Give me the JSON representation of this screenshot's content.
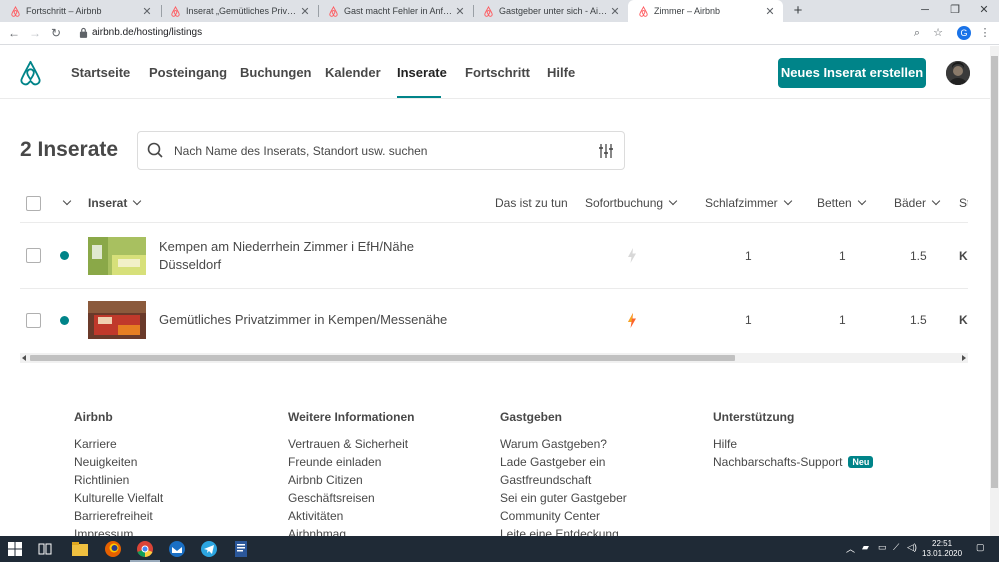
{
  "browser": {
    "tabs": [
      {
        "title": "Fortschritt – Airbnb"
      },
      {
        "title": "Inserat „Gemütliches Privatzimmer"
      },
      {
        "title": "Gast macht Fehler in Anfrage, ke"
      },
      {
        "title": "Gastgeber unter sich - Airbnb Co"
      },
      {
        "title": "Zimmer – Airbnb"
      }
    ],
    "url": "airbnb.de/hosting/listings"
  },
  "header": {
    "nav": [
      "Startseite",
      "Posteingang",
      "Buchungen",
      "Kalender",
      "Inserate",
      "Fortschritt",
      "Hilfe"
    ],
    "active_nav": "Inserate",
    "new_listing_label": "Neues Inserat erstellen"
  },
  "listings": {
    "count_label": "2 Inserate",
    "search_placeholder": "Nach Name des Inserats, Standort usw. suchen",
    "columns": [
      "Inserat",
      "Das ist zu tun",
      "Sofortbuchung",
      "Schlafzimmer",
      "Betten",
      "Bäder",
      "St"
    ],
    "rows": [
      {
        "title": "Kempen am Niederrhein Zimmer i EfH/Nähe Düsseldorf",
        "instant_book": "off",
        "bedrooms": "1",
        "beds": "1",
        "baths": "1.5",
        "status_partial": "Ke"
      },
      {
        "title": "Gemütliches Privatzimmer in Kempen/Messenähe",
        "instant_book": "on",
        "bedrooms": "1",
        "beds": "1",
        "baths": "1.5",
        "status_partial": "Ke"
      }
    ]
  },
  "footer": {
    "columns": [
      {
        "heading": "Airbnb",
        "links": [
          "Karriere",
          "Neuigkeiten",
          "Richtlinien",
          "Kulturelle Vielfalt",
          "Barrierefreiheit",
          "Impressum"
        ]
      },
      {
        "heading": "Weitere Informationen",
        "links": [
          "Vertrauen & Sicherheit",
          "Freunde einladen",
          "Airbnb Citizen",
          "Geschäftsreisen",
          "Aktivitäten",
          "Airbnbmag"
        ]
      },
      {
        "heading": "Gastgeben",
        "links": [
          "Warum Gastgeben?",
          "Lade Gastgeber ein",
          "Gastfreundschaft",
          "Sei ein guter Gastgeber",
          "Community Center",
          "Leite eine Entdeckung"
        ]
      },
      {
        "heading": "Unterstützung",
        "links": [
          "Hilfe",
          "Nachbarschafts-Support"
        ]
      }
    ],
    "new_badge": "Neu"
  },
  "taskbar": {
    "time": "22:51",
    "date": "13.01.2020"
  },
  "colors": {
    "accent": "#008489",
    "bolt_on": "#fc642d",
    "bolt_off": "#d8d8d8"
  }
}
